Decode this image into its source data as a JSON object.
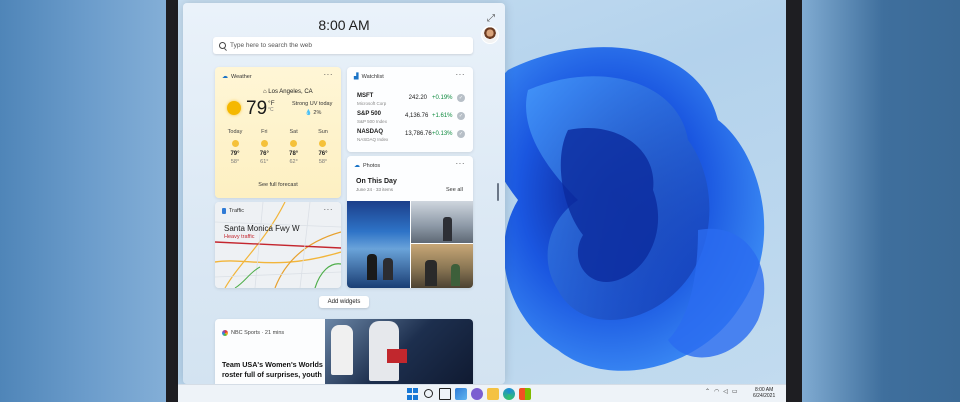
{
  "panel": {
    "clock": "8:00 AM",
    "search_placeholder": "Type here to search the web"
  },
  "weather": {
    "header": "Weather",
    "location": "Los Angeles, CA",
    "temp": "79",
    "unit_f": "°F",
    "unit_c": "°C",
    "condition": "Strong UV today",
    "rain": "2%",
    "forecast": [
      {
        "day": "Today",
        "hi": "79°",
        "lo": "58°"
      },
      {
        "day": "Fri",
        "hi": "76°",
        "lo": "61°"
      },
      {
        "day": "Sat",
        "hi": "78°",
        "lo": "62°"
      },
      {
        "day": "Sun",
        "hi": "76°",
        "lo": "58°"
      }
    ],
    "link": "See full forecast"
  },
  "watchlist": {
    "header": "Watchlist",
    "stocks": [
      {
        "symbol": "MSFT",
        "name": "Microsoft Corp",
        "price": "242.20",
        "change": "+0.19%"
      },
      {
        "symbol": "S&P 500",
        "name": "S&P 500 Index",
        "price": "4,136.76",
        "change": "+1.61%"
      },
      {
        "symbol": "NASDAQ",
        "name": "NASDAQ Index",
        "price": "13,786.76",
        "change": "+0.13%"
      }
    ]
  },
  "photos": {
    "header": "Photos",
    "title": "On This Day",
    "subtitle": "June 24 · 33 items",
    "see_all": "See all"
  },
  "traffic": {
    "header": "Traffic",
    "road": "Santa Monica Fwy W",
    "status": "Heavy traffic"
  },
  "add_widgets": "Add widgets",
  "news": {
    "source": "NBC Sports · 21 mins",
    "title": "Team USA's Women's Worlds roster full of surprises, youth"
  },
  "taskbar": {
    "time": "8:00 AM",
    "date": "6/24/2021"
  },
  "colors": {
    "accent": "#1878d6",
    "positive": "#0f8a3f",
    "traffic_alert": "#c4262e"
  },
  "icons": [
    "search-icon",
    "expand-icon",
    "more-icon",
    "cloud-icon",
    "chart-icon",
    "sun-icon",
    "check-icon",
    "start-icon",
    "task-view-icon",
    "widgets-icon",
    "chat-icon",
    "file-explorer-icon",
    "edge-icon",
    "store-icon",
    "wifi-icon",
    "volume-icon"
  ]
}
